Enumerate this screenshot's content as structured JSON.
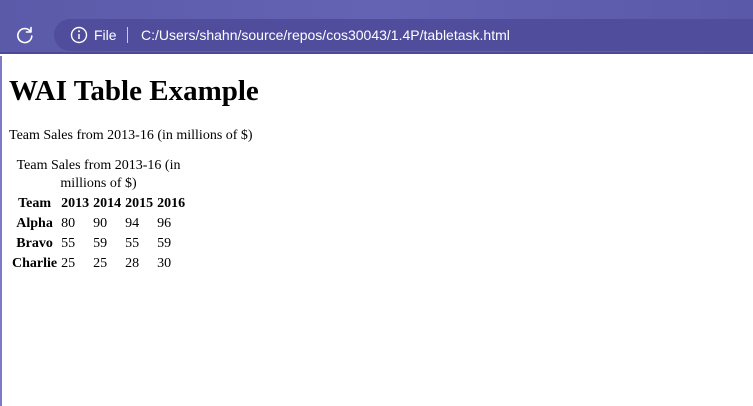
{
  "browser": {
    "scheme_label": "File",
    "url": "C:/Users/shahn/source/repos/cos30043/1.4P/tabletask.html",
    "reload_icon": "reload-icon",
    "info_icon": "info-icon",
    "accent_color": "#5b5aa9"
  },
  "page": {
    "title": "WAI Table Example",
    "intro": "Team Sales from 2013-16 (in millions of $)",
    "table": {
      "caption": "Team Sales from 2013-16 (in millions of $)",
      "headers": [
        "Team",
        "2013",
        "2014",
        "2015",
        "2016"
      ],
      "rows": [
        {
          "team": "Alpha",
          "values": [
            "80",
            "90",
            "94",
            "96"
          ]
        },
        {
          "team": "Bravo",
          "values": [
            "55",
            "59",
            "55",
            "59"
          ]
        },
        {
          "team": "Charlie",
          "values": [
            "25",
            "25",
            "28",
            "30"
          ]
        }
      ]
    }
  }
}
